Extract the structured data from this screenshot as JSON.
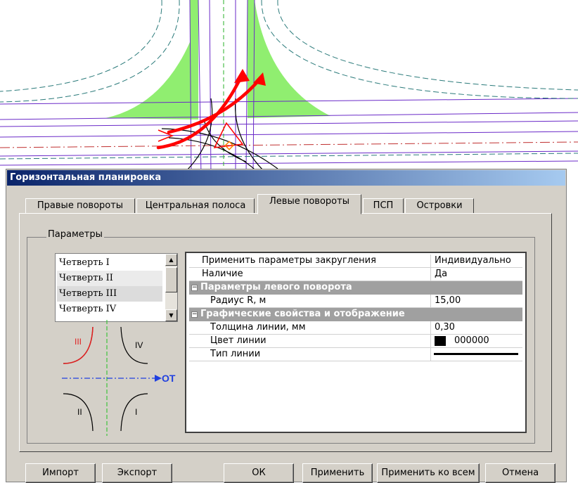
{
  "dialog": {
    "title": "Горизонтальная планировка"
  },
  "tabs": [
    {
      "label": "Правые повороты",
      "active": false
    },
    {
      "label": "Центральная полоса",
      "active": false
    },
    {
      "label": "Левые повороты",
      "active": true
    },
    {
      "label": "ПСП",
      "active": false
    },
    {
      "label": "Островки",
      "active": false
    }
  ],
  "group": {
    "label": "Параметры"
  },
  "quarters": {
    "items": [
      "Четверть I",
      "Четверть II",
      "Четверть III",
      "Четверть  IV"
    ],
    "selected": "Четверть III"
  },
  "diagram": {
    "labels": {
      "q1": "I",
      "q2": "II",
      "q3": "III",
      "q4": "IV",
      "axis": "ОТ"
    }
  },
  "properties": {
    "rows": [
      {
        "name": "Применить параметры закругления",
        "value": "Индивидуально"
      },
      {
        "name": "Наличие",
        "value": "Да"
      },
      {
        "category": "Параметры левого поворота",
        "expander": "−"
      },
      {
        "name": "Радиус R, м",
        "value": "15,00"
      },
      {
        "category": "Графические свойства  и отображение",
        "expander": "−"
      },
      {
        "name": "Толщина линии, мм",
        "value": "0,30"
      },
      {
        "name": "Цвет линии",
        "value": "000000",
        "swatch": "#000000"
      },
      {
        "name": "Тип линии",
        "value": ""
      }
    ]
  },
  "buttons": {
    "import": "Импорт",
    "export": "Экспорт",
    "ok": "ОК",
    "apply": "Применить",
    "apply_all": "Применить ко всем",
    "cancel": "Отмена"
  },
  "colors": {
    "accent": "#0a246a",
    "island": "#90ee70",
    "turn_arrow": "#ff0000"
  }
}
